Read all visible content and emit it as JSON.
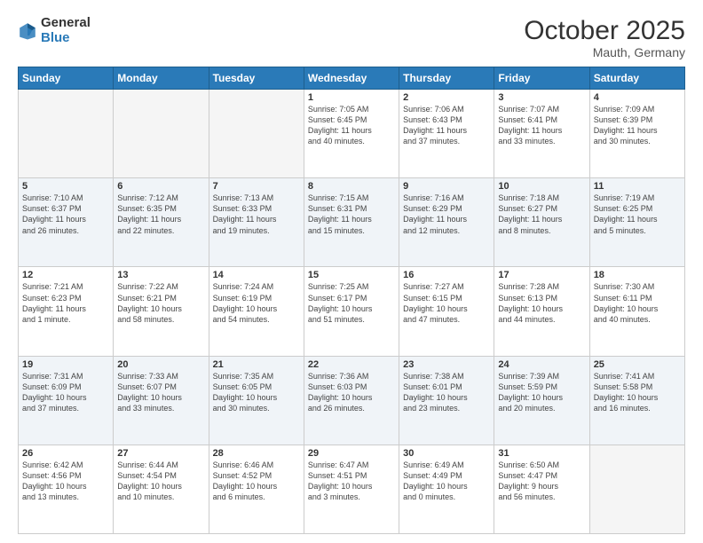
{
  "logo": {
    "general": "General",
    "blue": "Blue"
  },
  "header": {
    "month": "October 2025",
    "location": "Mauth, Germany"
  },
  "weekdays": [
    "Sunday",
    "Monday",
    "Tuesday",
    "Wednesday",
    "Thursday",
    "Friday",
    "Saturday"
  ],
  "weeks": [
    [
      {
        "day": "",
        "info": ""
      },
      {
        "day": "",
        "info": ""
      },
      {
        "day": "",
        "info": ""
      },
      {
        "day": "1",
        "info": "Sunrise: 7:05 AM\nSunset: 6:45 PM\nDaylight: 11 hours\nand 40 minutes."
      },
      {
        "day": "2",
        "info": "Sunrise: 7:06 AM\nSunset: 6:43 PM\nDaylight: 11 hours\nand 37 minutes."
      },
      {
        "day": "3",
        "info": "Sunrise: 7:07 AM\nSunset: 6:41 PM\nDaylight: 11 hours\nand 33 minutes."
      },
      {
        "day": "4",
        "info": "Sunrise: 7:09 AM\nSunset: 6:39 PM\nDaylight: 11 hours\nand 30 minutes."
      }
    ],
    [
      {
        "day": "5",
        "info": "Sunrise: 7:10 AM\nSunset: 6:37 PM\nDaylight: 11 hours\nand 26 minutes."
      },
      {
        "day": "6",
        "info": "Sunrise: 7:12 AM\nSunset: 6:35 PM\nDaylight: 11 hours\nand 22 minutes."
      },
      {
        "day": "7",
        "info": "Sunrise: 7:13 AM\nSunset: 6:33 PM\nDaylight: 11 hours\nand 19 minutes."
      },
      {
        "day": "8",
        "info": "Sunrise: 7:15 AM\nSunset: 6:31 PM\nDaylight: 11 hours\nand 15 minutes."
      },
      {
        "day": "9",
        "info": "Sunrise: 7:16 AM\nSunset: 6:29 PM\nDaylight: 11 hours\nand 12 minutes."
      },
      {
        "day": "10",
        "info": "Sunrise: 7:18 AM\nSunset: 6:27 PM\nDaylight: 11 hours\nand 8 minutes."
      },
      {
        "day": "11",
        "info": "Sunrise: 7:19 AM\nSunset: 6:25 PM\nDaylight: 11 hours\nand 5 minutes."
      }
    ],
    [
      {
        "day": "12",
        "info": "Sunrise: 7:21 AM\nSunset: 6:23 PM\nDaylight: 11 hours\nand 1 minute."
      },
      {
        "day": "13",
        "info": "Sunrise: 7:22 AM\nSunset: 6:21 PM\nDaylight: 10 hours\nand 58 minutes."
      },
      {
        "day": "14",
        "info": "Sunrise: 7:24 AM\nSunset: 6:19 PM\nDaylight: 10 hours\nand 54 minutes."
      },
      {
        "day": "15",
        "info": "Sunrise: 7:25 AM\nSunset: 6:17 PM\nDaylight: 10 hours\nand 51 minutes."
      },
      {
        "day": "16",
        "info": "Sunrise: 7:27 AM\nSunset: 6:15 PM\nDaylight: 10 hours\nand 47 minutes."
      },
      {
        "day": "17",
        "info": "Sunrise: 7:28 AM\nSunset: 6:13 PM\nDaylight: 10 hours\nand 44 minutes."
      },
      {
        "day": "18",
        "info": "Sunrise: 7:30 AM\nSunset: 6:11 PM\nDaylight: 10 hours\nand 40 minutes."
      }
    ],
    [
      {
        "day": "19",
        "info": "Sunrise: 7:31 AM\nSunset: 6:09 PM\nDaylight: 10 hours\nand 37 minutes."
      },
      {
        "day": "20",
        "info": "Sunrise: 7:33 AM\nSunset: 6:07 PM\nDaylight: 10 hours\nand 33 minutes."
      },
      {
        "day": "21",
        "info": "Sunrise: 7:35 AM\nSunset: 6:05 PM\nDaylight: 10 hours\nand 30 minutes."
      },
      {
        "day": "22",
        "info": "Sunrise: 7:36 AM\nSunset: 6:03 PM\nDaylight: 10 hours\nand 26 minutes."
      },
      {
        "day": "23",
        "info": "Sunrise: 7:38 AM\nSunset: 6:01 PM\nDaylight: 10 hours\nand 23 minutes."
      },
      {
        "day": "24",
        "info": "Sunrise: 7:39 AM\nSunset: 5:59 PM\nDaylight: 10 hours\nand 20 minutes."
      },
      {
        "day": "25",
        "info": "Sunrise: 7:41 AM\nSunset: 5:58 PM\nDaylight: 10 hours\nand 16 minutes."
      }
    ],
    [
      {
        "day": "26",
        "info": "Sunrise: 6:42 AM\nSunset: 4:56 PM\nDaylight: 10 hours\nand 13 minutes."
      },
      {
        "day": "27",
        "info": "Sunrise: 6:44 AM\nSunset: 4:54 PM\nDaylight: 10 hours\nand 10 minutes."
      },
      {
        "day": "28",
        "info": "Sunrise: 6:46 AM\nSunset: 4:52 PM\nDaylight: 10 hours\nand 6 minutes."
      },
      {
        "day": "29",
        "info": "Sunrise: 6:47 AM\nSunset: 4:51 PM\nDaylight: 10 hours\nand 3 minutes."
      },
      {
        "day": "30",
        "info": "Sunrise: 6:49 AM\nSunset: 4:49 PM\nDaylight: 10 hours\nand 0 minutes."
      },
      {
        "day": "31",
        "info": "Sunrise: 6:50 AM\nSunset: 4:47 PM\nDaylight: 9 hours\nand 56 minutes."
      },
      {
        "day": "",
        "info": ""
      }
    ]
  ]
}
